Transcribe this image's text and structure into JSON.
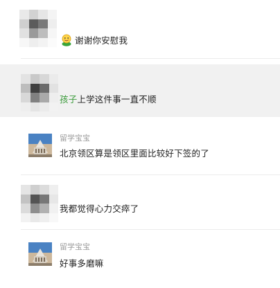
{
  "messages": [
    {
      "avatar": "pixelated-avatar",
      "sender": "",
      "has_emoji": true,
      "emoji_icon": "smiling-face-icon",
      "mention": "",
      "text": "谢谢你安慰我"
    },
    {
      "avatar": "pixelated-avatar",
      "sender": "",
      "has_emoji": false,
      "mention": "孩子",
      "text": "上学这件事一直不顺"
    },
    {
      "avatar": "building-photo-avatar",
      "sender": "留学宝宝",
      "has_emoji": false,
      "mention": "",
      "text": "北京领区算是领区里面比较好下签的了"
    },
    {
      "avatar": "pixelated-avatar",
      "sender": "",
      "has_emoji": false,
      "mention": "",
      "text": "我都觉得心力交瘁了"
    },
    {
      "avatar": "building-photo-avatar",
      "sender": "留学宝宝",
      "has_emoji": false,
      "mention": "",
      "text": "好事多磨嘛"
    }
  ],
  "colors": {
    "highlight_row": "#f1f1f1",
    "mention": "#3a9b3a",
    "sender": "#9c9c9c",
    "text": "#222222",
    "divider": "#ececec"
  }
}
